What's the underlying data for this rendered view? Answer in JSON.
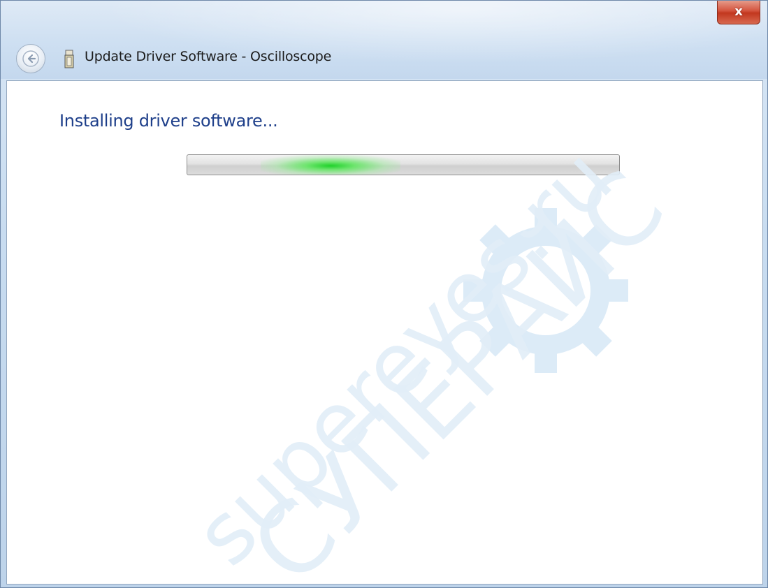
{
  "window": {
    "title": "Update Driver Software - Oscilloscope",
    "close_glyph": "x"
  },
  "main": {
    "heading": "Installing driver software..."
  },
  "progress": {
    "mode": "indeterminate",
    "glow_color": "#1fd12a"
  },
  "icons": {
    "back": "back-arrow-icon",
    "device": "usb-device-icon",
    "close": "close-icon"
  },
  "watermark": {
    "line1": "supereyes.ru",
    "line2": "СУПЕРАЙС",
    "color": "#dcebf7"
  }
}
